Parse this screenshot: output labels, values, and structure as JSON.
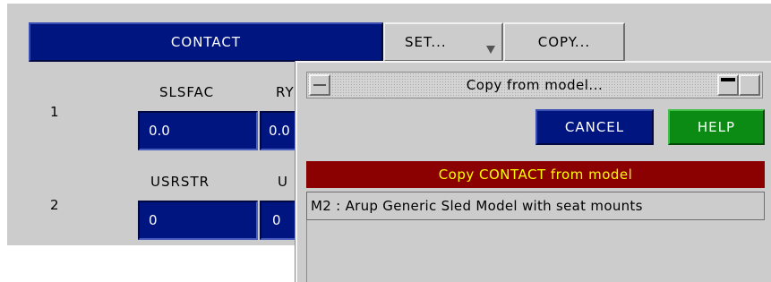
{
  "header": {
    "contact_label": "CONTACT",
    "set_label": "SET...",
    "copy_label": "COPY..."
  },
  "rows": [
    {
      "number": "1",
      "field1_label": "SLSFAC",
      "field2_label": "RY",
      "field1_value": "0.0",
      "field2_value": "0.0"
    },
    {
      "number": "2",
      "field1_label": "USRSTR",
      "field2_label": "U",
      "field1_value": "0",
      "field2_value": "0"
    }
  ],
  "dialog": {
    "title": "Copy from model...",
    "cancel_label": "CANCEL",
    "help_label": "HELP",
    "list_header": "Copy CONTACT from model",
    "list_items": [
      "M2 : Arup Generic Sled Model with seat mounts"
    ]
  },
  "icons": {
    "dropdown": "dropdown-arrow-icon",
    "minimize": "minimize-icon",
    "maximize": "maximize-icon",
    "menu": "window-menu-icon"
  },
  "colors": {
    "panel_bg": "#cccccc",
    "field_blue": "#00157f",
    "help_green": "#0b8a14",
    "list_header_bg": "#8b0000",
    "list_header_text": "#ffff00"
  }
}
